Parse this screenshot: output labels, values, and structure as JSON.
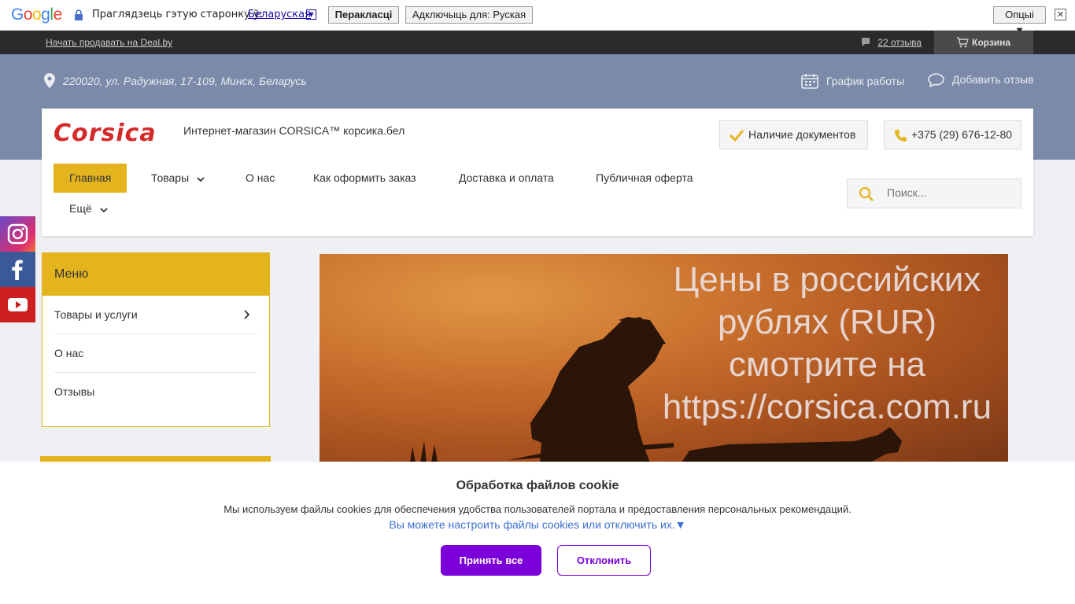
{
  "translate_bar": {
    "logo": "Google",
    "prompt": "Праглядзець гэтую старонку ў:",
    "language": "Беларуская",
    "dropdown_glyph": "▼",
    "translate_button": "Перакласці",
    "turn_off_button": "Адключыць для: Руская",
    "options_button": "Опцыі ▼",
    "close_glyph": "✕"
  },
  "deal_bar": {
    "sell_link": "Начать продавать на Deal.by",
    "reviews_link": "22 отзыва",
    "cart": "Корзина"
  },
  "header": {
    "address": "220020, ул. Радужная, 17-109, Минск, Беларусь",
    "schedule": "График работы",
    "add_review": "Добавить отзыв"
  },
  "card": {
    "logo_text": "Corsica",
    "tagline": "Интернет-магазин CORSICA™ корсика.бел",
    "docs_button": "Наличие документов",
    "phone": "+375 (29) 676-12-80",
    "search_placeholder": "Поиск..."
  },
  "nav": {
    "items": [
      {
        "label": "Главная",
        "active": true
      },
      {
        "label": "Товары",
        "has_dropdown": true
      },
      {
        "label": "О нас"
      },
      {
        "label": "Как оформить заказ"
      },
      {
        "label": "Доставка и оплата"
      },
      {
        "label": "Публичная оферта"
      },
      {
        "label": "Ещё",
        "has_dropdown": true
      }
    ]
  },
  "social": [
    "instagram-icon",
    "facebook-icon",
    "youtube-icon"
  ],
  "sidebar": {
    "title": "Меню",
    "items": [
      {
        "label": "Товары и услуги",
        "has_arrow": true
      },
      {
        "label": "О нас"
      },
      {
        "label": "Отзывы"
      }
    ]
  },
  "banner": {
    "line1": "Цены в российских",
    "line2": "рублях (RUR)",
    "line3": "смотрите на",
    "line4": "https://corsica.com.ru"
  },
  "cookie": {
    "title": "Обработка файлов cookie",
    "text": "Мы используем файлы cookies для обеспечения удобства пользователей портала и предоставления персональных рекомендаций.",
    "link": "Вы можете настроить файлы cookies или отключить их.▼",
    "accept": "Принять все",
    "decline": "Отклонить"
  },
  "colors": {
    "accent_yellow": "#e4b41f",
    "header_blue": "#7a8aa8",
    "cookie_purple": "#7b00d9",
    "logo_red": "#d42a2a"
  }
}
